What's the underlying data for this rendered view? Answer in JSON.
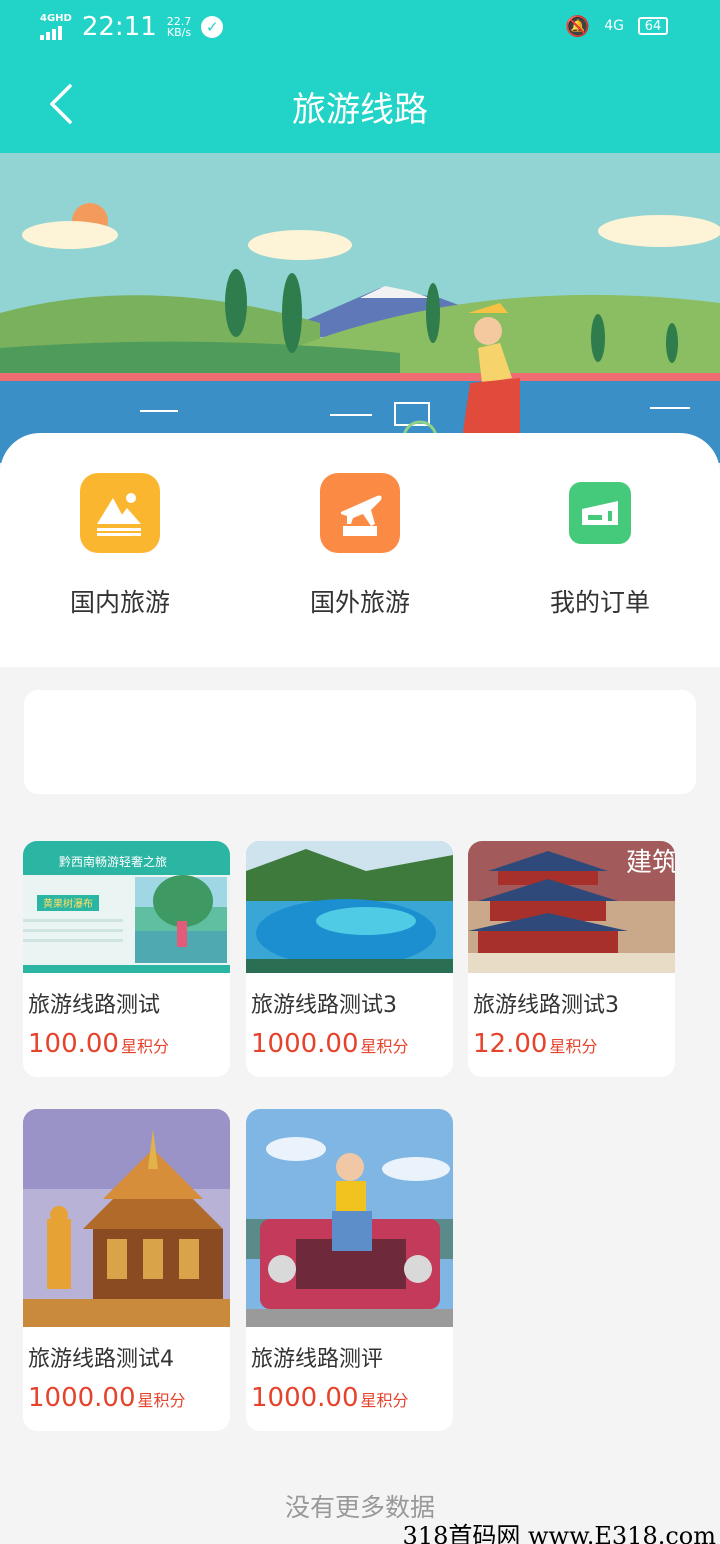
{
  "status_bar": {
    "network": "4GHD",
    "time": "22:11",
    "speed_value": "22.7",
    "speed_unit": "KB/s",
    "network_right": "4G",
    "battery": "64"
  },
  "header": {
    "title": "旅游线路"
  },
  "categories": [
    {
      "label": "国内旅游",
      "icon": "mountain-icon",
      "color": "#fbb630"
    },
    {
      "label": "国外旅游",
      "icon": "airplane-icon",
      "color": "#fb8a45"
    },
    {
      "label": "我的订单",
      "icon": "ticket-icon",
      "color": "#45c97a"
    }
  ],
  "products": [
    {
      "name": "旅游线路测试",
      "price": "100.00",
      "unit": "星积分"
    },
    {
      "name": "旅游线路测试3",
      "price": "1000.00",
      "unit": "星积分"
    },
    {
      "name": "旅游线路测试3",
      "price": "12.00",
      "unit": "星积分"
    },
    {
      "name": "旅游线路测试4",
      "price": "1000.00",
      "unit": "星积分"
    },
    {
      "name": "旅游线路测评",
      "price": "1000.00",
      "unit": "星积分"
    }
  ],
  "product_images": {
    "p1_heading": "黔西南畅游轻奢之旅",
    "p1_tag": "黄果树瀑布",
    "p3_text": "建筑之美"
  },
  "footer": {
    "no_more": "没有更多数据"
  },
  "watermark": "318首码网 www.E318.com",
  "colors": {
    "theme": "#22d3c8",
    "price": "#e5432c"
  }
}
